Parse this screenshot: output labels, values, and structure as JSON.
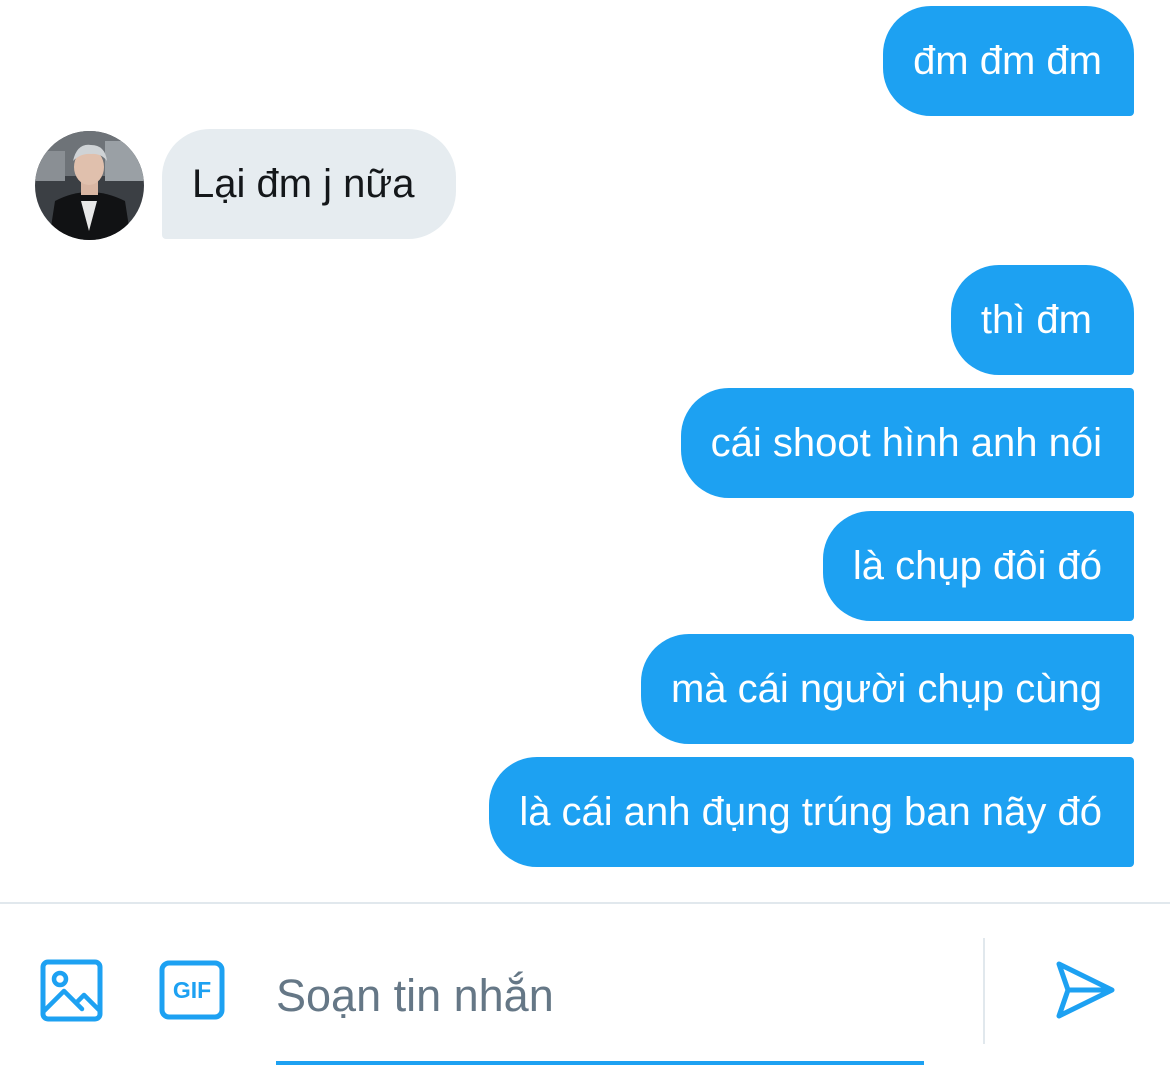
{
  "colors": {
    "accent": "#1da1f2",
    "incoming_bubble": "#e6ecf0",
    "outgoing_text": "#ffffff",
    "incoming_text": "#14171a",
    "placeholder": "#657786",
    "divider": "#e1e8ed"
  },
  "conversation": {
    "messages": [
      {
        "direction": "outgoing",
        "text": "đm đm đm"
      },
      {
        "direction": "incoming",
        "text": "Lại đm j nữa",
        "avatar_icon": "user-avatar-photo"
      },
      {
        "direction": "outgoing",
        "text": "thì đm"
      },
      {
        "direction": "outgoing",
        "text": "cái shoot hình anh nói"
      },
      {
        "direction": "outgoing",
        "text": "là chụp đôi đó"
      },
      {
        "direction": "outgoing",
        "text": "mà cái người chụp cùng"
      },
      {
        "direction": "outgoing",
        "text": "là cái anh đụng trúng ban nãy đó"
      }
    ]
  },
  "composer": {
    "placeholder": "Soạn tin nhắn",
    "value": "",
    "image_button_icon": "image-icon",
    "gif_button_label": "GIF",
    "send_button_icon": "send-icon"
  }
}
